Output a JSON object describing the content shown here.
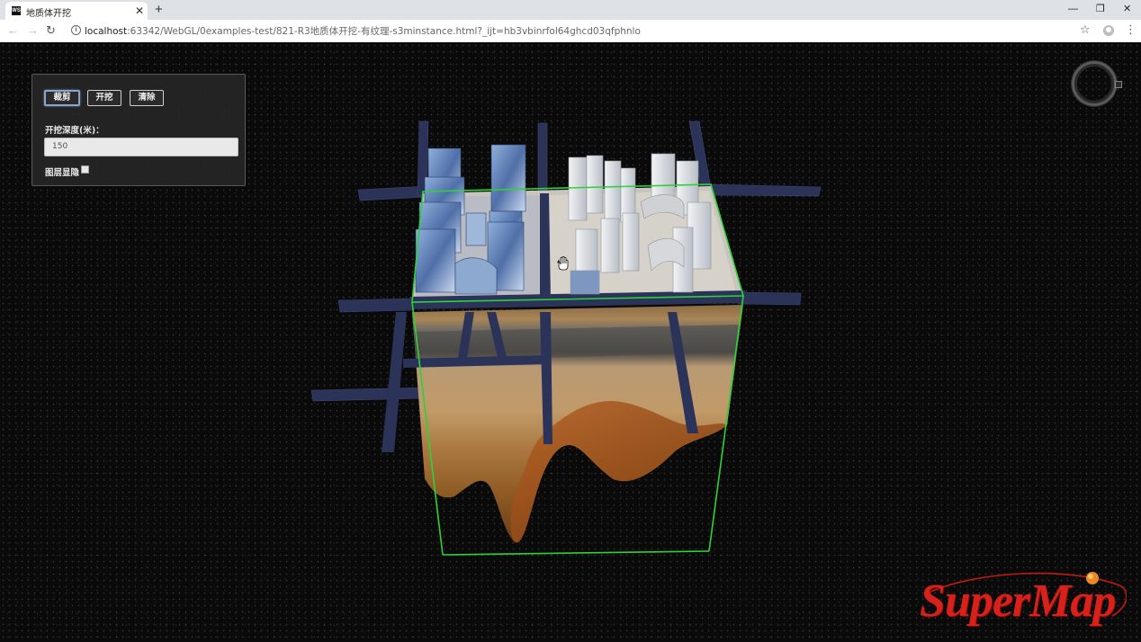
{
  "browser": {
    "tab_title": "地质体开挖",
    "favicon": "WS",
    "url_host": "localhost",
    "url_rest": ":63342/WebGL/0examples-test/821-R3地质体开挖-有纹理-s3minstance.html?_ijt=hb3vbinrfol64ghcd03qfphnlo"
  },
  "panel": {
    "btn_clip": "裁剪",
    "btn_excavate": "开挖",
    "btn_clear": "清除",
    "depth_label": "开挖深度(米)：",
    "depth_value": "150",
    "hide_layer_label": "图层显隐"
  },
  "logo": {
    "text": "SuperMap",
    "accent": "#d8211a"
  },
  "icons": [
    "close-icon",
    "plus-icon",
    "back-icon",
    "forward-icon",
    "reload-icon",
    "info-icon",
    "star-icon",
    "profile-icon",
    "menu-icon",
    "compass-icon",
    "hand-cursor-icon"
  ]
}
